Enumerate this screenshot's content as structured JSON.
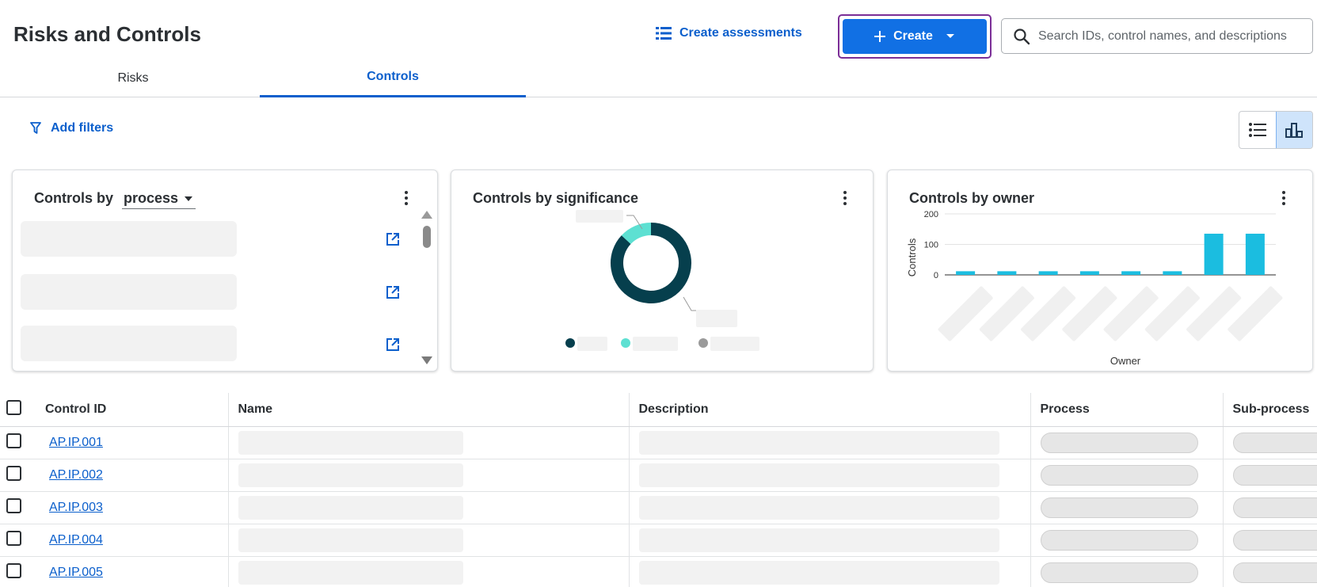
{
  "header": {
    "title": "Risks and Controls",
    "create_assessments_label": "Create assessments",
    "create_label": "Create",
    "search_placeholder": "Search IDs, control names, and descriptions"
  },
  "tabs": [
    {
      "label": "Risks",
      "active": false
    },
    {
      "label": "Controls",
      "active": true
    }
  ],
  "filters": {
    "add_filters_label": "Add filters"
  },
  "view_toggle": {
    "options": [
      "list-view-icon",
      "chart-view-icon"
    ],
    "active": "chart-view-icon"
  },
  "cards": {
    "process": {
      "title_prefix": "Controls by",
      "selected_option": "process"
    },
    "significance": {
      "title": "Controls by significance",
      "chart_data": {
        "type": "pie",
        "values": [
          87,
          13
        ],
        "colors": [
          "#063f4d",
          "#5de0d2"
        ]
      }
    },
    "owner": {
      "title": "Controls by owner",
      "chart_data": {
        "type": "bar",
        "xlabel": "Owner",
        "ylabel": "Controls",
        "ylim": [
          0,
          200
        ],
        "yticks": [
          0,
          100,
          200
        ],
        "values": [
          12,
          12,
          12,
          12,
          12,
          12,
          135,
          135
        ],
        "color": "#1bbde0"
      }
    }
  },
  "table": {
    "columns": [
      "Control ID",
      "Name",
      "Description",
      "Process",
      "Sub-process"
    ],
    "rows": [
      {
        "id": "AP.IP.001"
      },
      {
        "id": "AP.IP.002"
      },
      {
        "id": "AP.IP.003"
      },
      {
        "id": "AP.IP.004"
      },
      {
        "id": "AP.IP.005"
      }
    ]
  },
  "colors": {
    "accent": "#1170e4",
    "link": "#0b5fcc",
    "focus_ring": "#7b2e97"
  }
}
